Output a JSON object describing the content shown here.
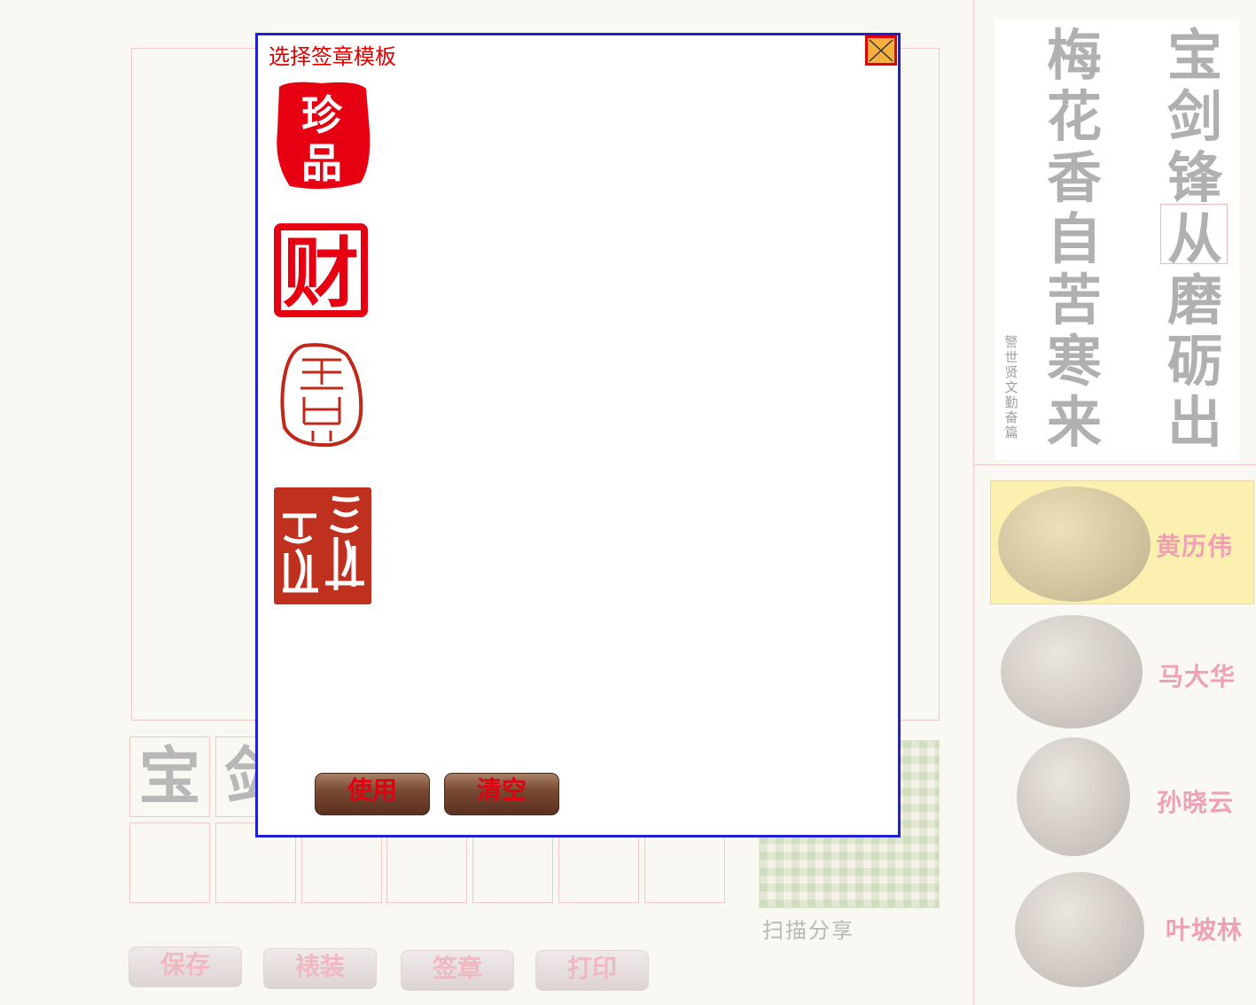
{
  "dialog": {
    "title": "选择签章模板",
    "use_label": "使用",
    "clear_label": "清空",
    "seals": [
      "珍品",
      "财",
      "篆印三",
      "篆印四"
    ]
  },
  "workspace": {
    "preview_chars": [
      "宝",
      "剑"
    ],
    "qr_caption": "扫描分享",
    "buttons": {
      "save": "保存",
      "mount": "裱装",
      "sign": "签章",
      "print": "打印"
    }
  },
  "poem": {
    "right_column": "宝剑锋从磨砺出",
    "left_column": "梅花香自苦寒来",
    "inscription": "警世贤文勤奋篇"
  },
  "artists": [
    "黄历伟",
    "马大华",
    "孙晓云",
    "叶坡林"
  ],
  "colors": {
    "accent_red": "#e00000",
    "dialog_border": "#2020d0",
    "selected_bg": "#fcf0b0"
  }
}
